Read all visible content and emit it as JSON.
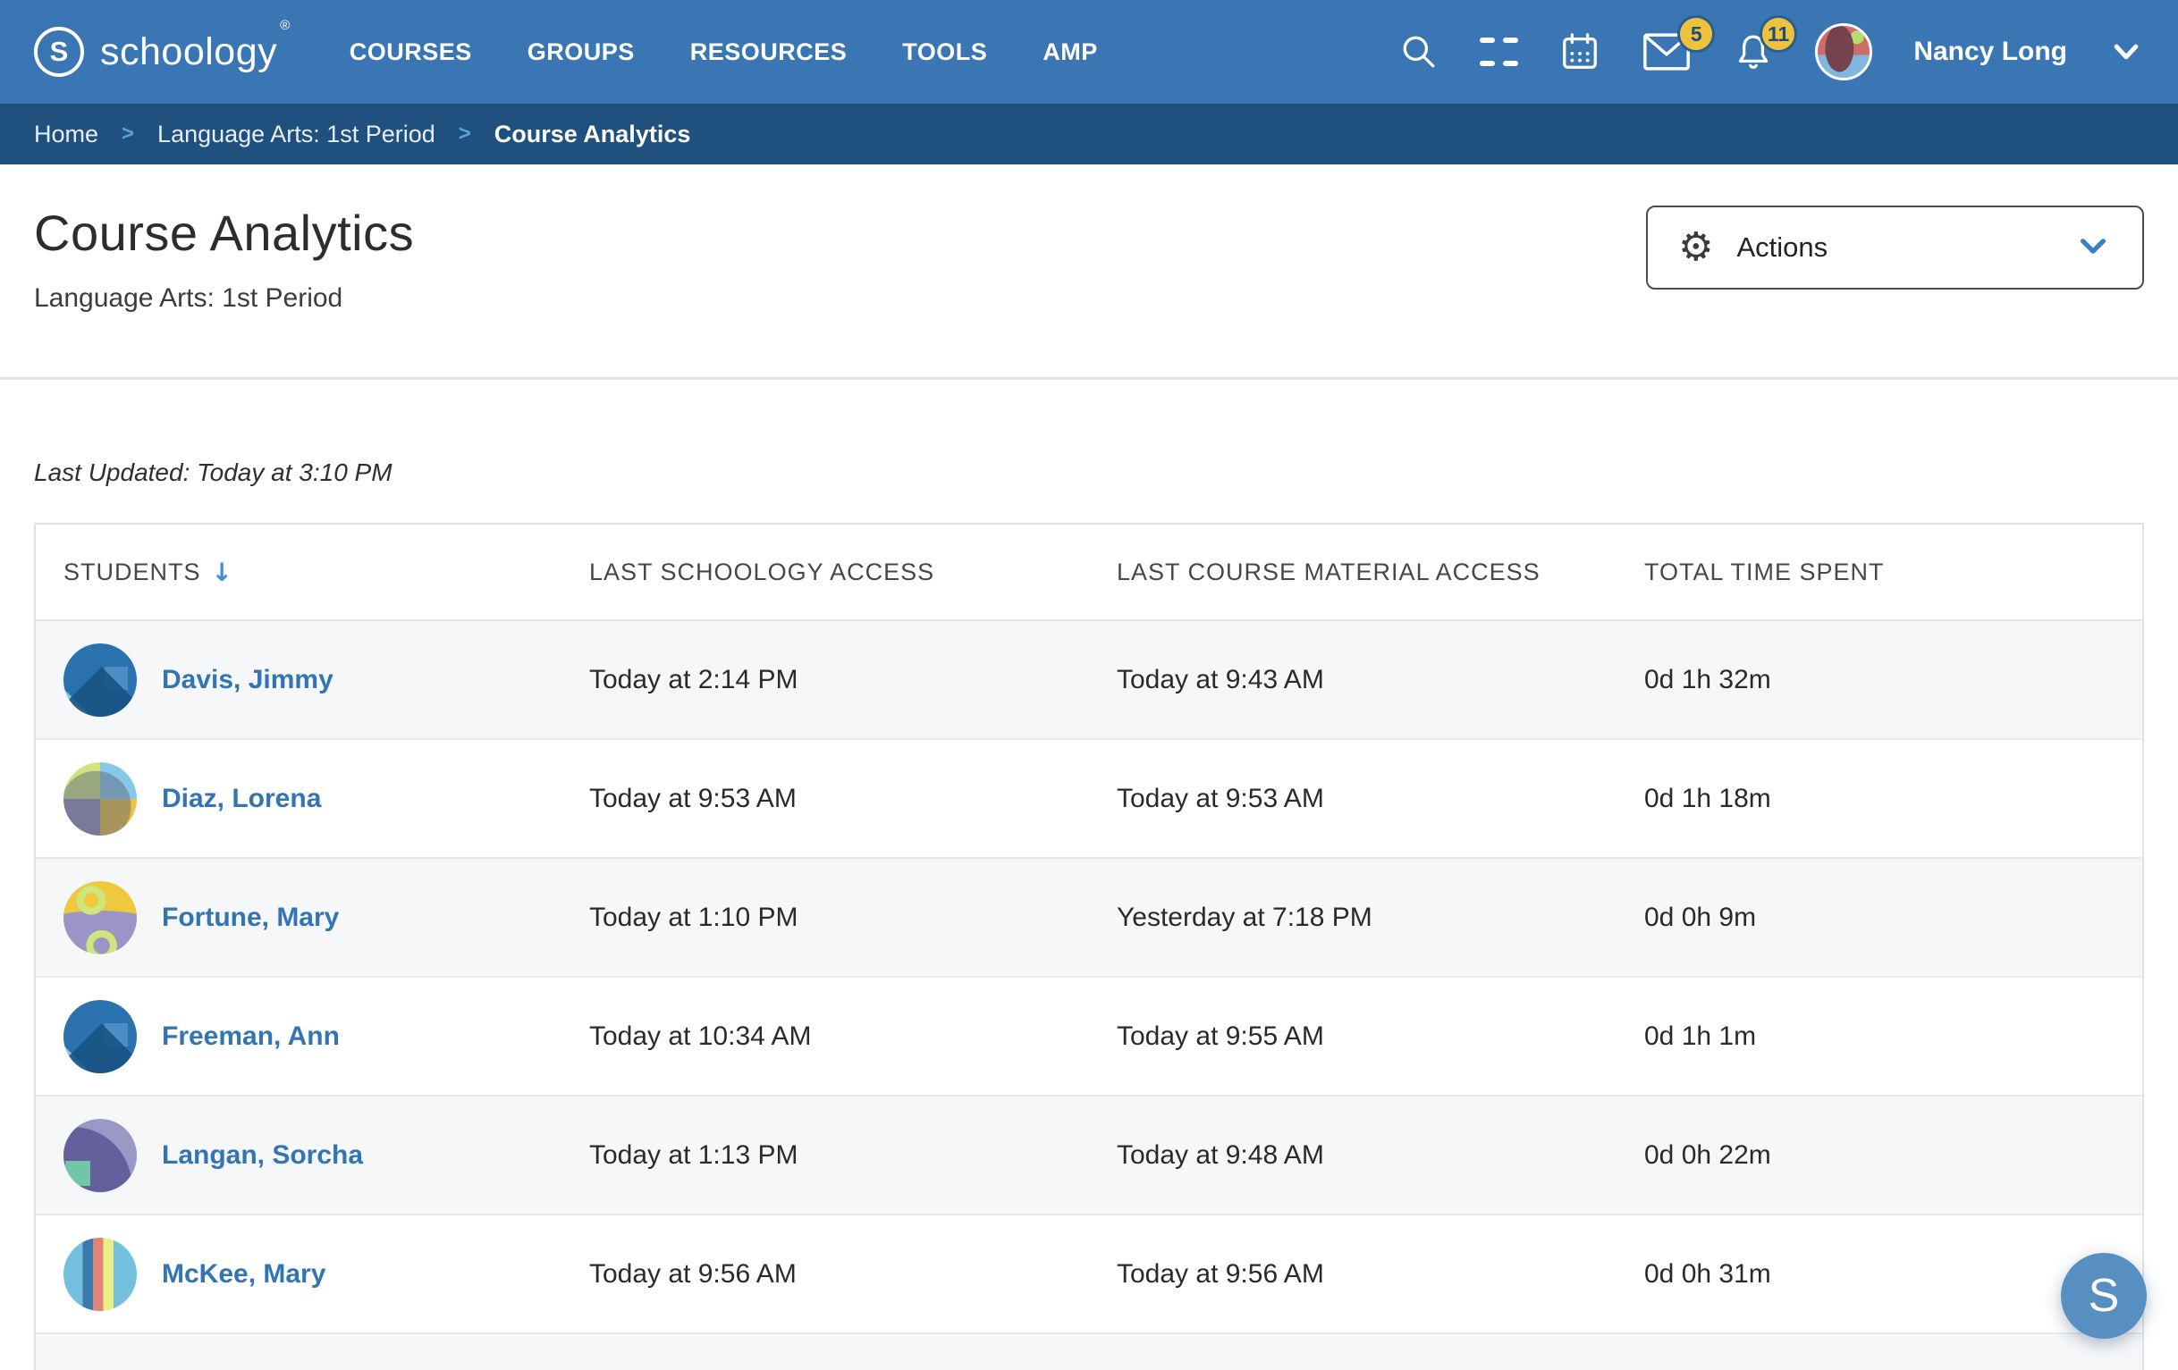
{
  "colors": {
    "nav-blue": "#3a76b4",
    "breadcrumb-blue": "#20507d",
    "link-blue": "#3374b5",
    "badge-yellow": "#efc23d",
    "badge-text": "#1d4d7a",
    "accent-blue": "#3f8fd6",
    "row-alt": "#f6f7f9",
    "fab-blue": "#588fc2"
  },
  "icons": {
    "search": "magnifier",
    "apps": "grid-2x2",
    "calendar": "calendar",
    "messages": "envelope",
    "notifications": "bell",
    "user_menu": "chevron-down",
    "actions_gear": "⚙",
    "actions_chevron": "chevron-down",
    "sort_desc": "↓"
  },
  "nav": {
    "logo_mark": "S",
    "logo_text": "schoology",
    "registered": "®",
    "items": [
      {
        "label": "COURSES"
      },
      {
        "label": "GROUPS"
      },
      {
        "label": "RESOURCES"
      },
      {
        "label": "TOOLS"
      },
      {
        "label": "AMP"
      }
    ],
    "messages_badge": "5",
    "notifications_badge": "11",
    "user_name": "Nancy Long"
  },
  "breadcrumb": {
    "separator": ">",
    "home": "Home",
    "course": "Language Arts: 1st Period",
    "current": "Course Analytics"
  },
  "page": {
    "title": "Course Analytics",
    "subtitle": "Language Arts: 1st Period",
    "actions_label": "Actions",
    "last_updated": "Last Updated: Today at 3:10 PM"
  },
  "table": {
    "headers": [
      "STUDENTS",
      "LAST SCHOOLOGY ACCESS",
      "LAST COURSE MATERIAL ACCESS",
      "TOTAL TIME SPENT"
    ],
    "rows": [
      {
        "name": "Davis, Jimmy",
        "last_schoology_access": "Today at 2:14 PM",
        "last_course_material_access": "Today at 9:43 AM",
        "total_time_spent": "0d 1h 32m",
        "avatar": "blue-abstract"
      },
      {
        "name": "Diaz, Lorena",
        "last_schoology_access": "Today at 9:53 AM",
        "last_course_material_access": "Today at 9:53 AM",
        "total_time_spent": "0d 1h 18m",
        "avatar": "color-quadrants"
      },
      {
        "name": "Fortune, Mary",
        "last_schoology_access": "Today at 1:10 PM",
        "last_course_material_access": "Yesterday at 7:18 PM",
        "total_time_spent": "0d 0h 9m",
        "avatar": "yellow-arcs"
      },
      {
        "name": "Freeman, Ann",
        "last_schoology_access": "Today at 10:34 AM",
        "last_course_material_access": "Today at 9:55 AM",
        "total_time_spent": "0d 1h 1m",
        "avatar": "blue-abstract"
      },
      {
        "name": "Langan, Sorcha",
        "last_schoology_access": "Today at 1:13 PM",
        "last_course_material_access": "Today at 9:48 AM",
        "total_time_spent": "0d 0h 22m",
        "avatar": "purple-crescent"
      },
      {
        "name": "McKee, Mary",
        "last_schoology_access": "Today at 9:56 AM",
        "last_course_material_access": "Today at 9:56 AM",
        "total_time_spent": "0d 0h 31m",
        "avatar": "blue-stripes"
      }
    ]
  },
  "fab": {
    "label": "S"
  }
}
